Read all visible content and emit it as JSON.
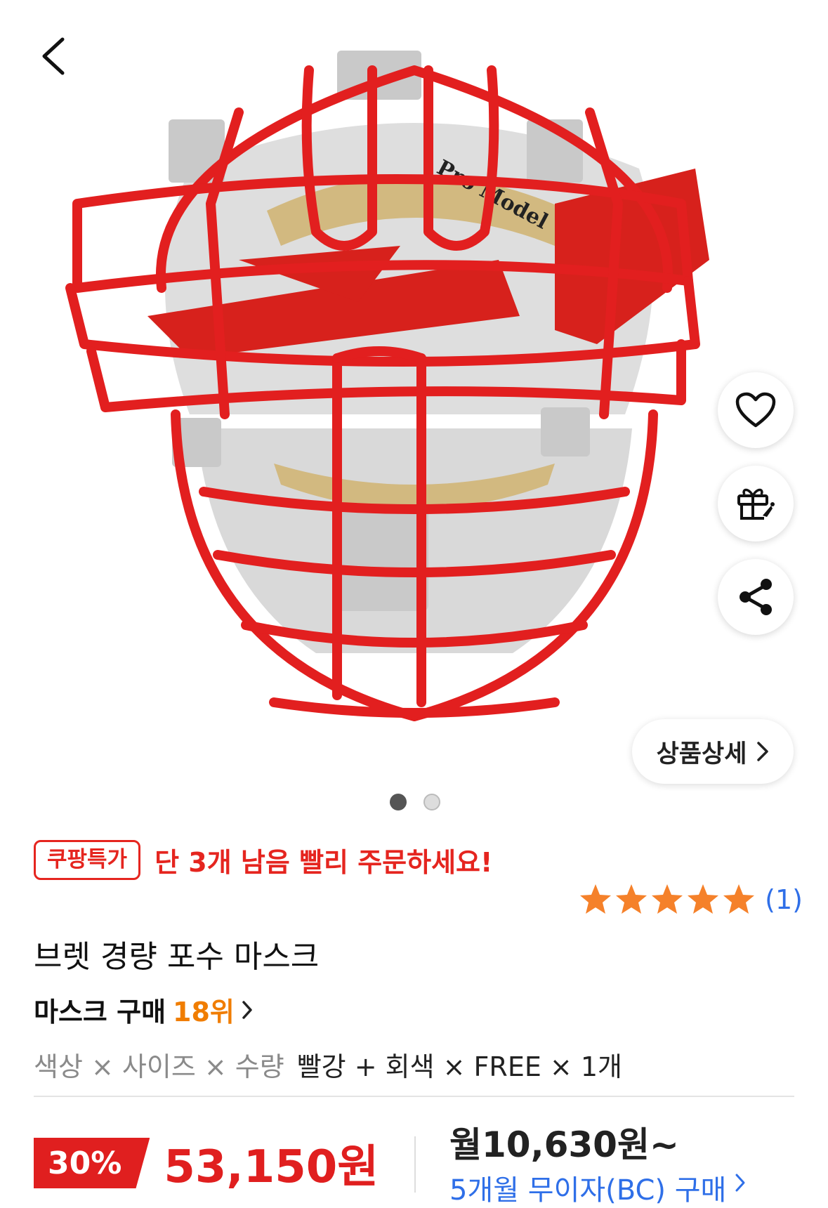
{
  "nav": {
    "back_icon": "chevron-left-icon"
  },
  "product_image": {
    "embossed_text": "Pro Model",
    "colors": {
      "frame": "#e21f1f",
      "pad": "#dcdcdc"
    }
  },
  "actions": [
    {
      "name": "wishlist",
      "icon": "heart-icon"
    },
    {
      "name": "gift",
      "icon": "gift-icon"
    },
    {
      "name": "share",
      "icon": "share-icon"
    }
  ],
  "detail_button": {
    "label": "상품상세",
    "icon": "chevron-right-icon"
  },
  "carousel": {
    "current": 1,
    "total": 2
  },
  "promo": {
    "badge": "쿠팡특가",
    "text": "단 3개 남음 빨리 주문하세요!"
  },
  "rating": {
    "stars": 5,
    "max": 5,
    "count": "(1)",
    "star_color": "#f5812a"
  },
  "product": {
    "title": "브렛 경량 포수 마스크",
    "rank_category": "마스크 구매",
    "rank_value": "18위",
    "option_labels": "색상 × 사이즈 × 수량",
    "option_values": "빨강 + 회색 × FREE × 1개"
  },
  "price": {
    "discount": "30%",
    "sale_price": "53,150원",
    "monthly": "월10,630원~",
    "installment": "5개월 무이자(BC) 구매",
    "accent_color": "#e01f1f"
  }
}
